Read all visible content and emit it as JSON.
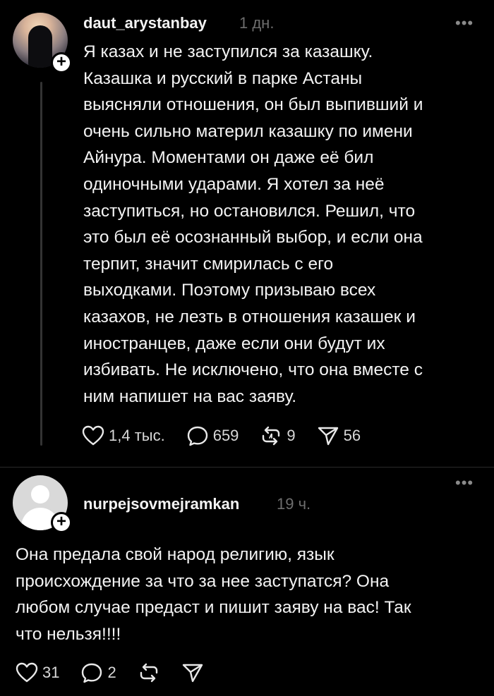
{
  "posts": [
    {
      "username": "daut_arystanbay",
      "time": "1 дн.",
      "more": "•••",
      "text": "Я казах и не заступился за казашку.\nКазашка и русский в парке Астаны\nвыясняли отношения, он был выпивший и\nочень сильно материл казашку по имени\nАйнура. Моментами он даже её бил\nодиночными ударами. Я хотел за неё\nзаступиться, но остановился. Решил, что\nэто был её осознанный выбор, и если она\nтерпит, значит смирилась с его\nвыходками. Поэтому призываю всех\nказахов, не лезть в отношения казашек и\nиностранцев, даже если они будут их\nизбивать. Не исключено, что она вместе с\nним напишет на вас заяву.",
      "likes": "1,4 тыс.",
      "comments": "659",
      "reposts": "9",
      "shares": "56",
      "icons": {
        "like": "heart-icon",
        "comment": "speech-bubble-icon",
        "repost": "repost-icon",
        "share": "send-icon"
      }
    },
    {
      "username": "nurpejsovmejramkan",
      "time": "19 ч.",
      "more": "•••",
      "text": "Она предала свой народ религию, язык\nпроисхождение за что за нее заступатся?  Она\nлюбом случае предаст и пишит заяву на вас! Так\nчто нельзя!!!!",
      "likes": "31",
      "comments": "2",
      "reposts": "",
      "shares": ""
    }
  ],
  "colors": {
    "background": "#000000",
    "text": "#f3f3f3",
    "muted": "#6e6e6e"
  }
}
